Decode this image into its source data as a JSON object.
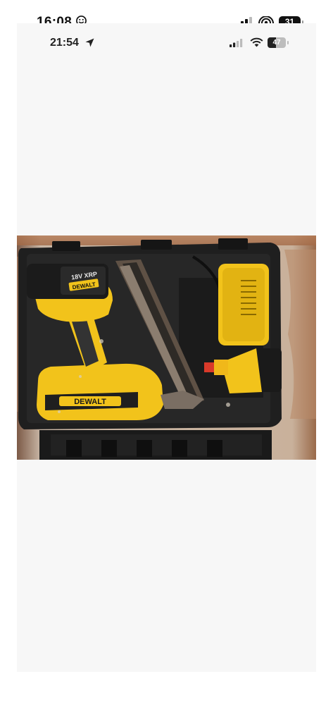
{
  "outer_status_bar": {
    "time": "16:08",
    "battery": "31",
    "icons": [
      "smiley-icon",
      "cellular-signal-icon",
      "hotspot-icon",
      "battery-icon"
    ]
  },
  "inner_status_bar": {
    "time": "21:54",
    "battery": "47",
    "battery_level": 0.47,
    "icons": [
      "location-arrow-icon",
      "cellular-signal-icon",
      "wifi-icon",
      "battery-icon"
    ]
  },
  "photo": {
    "brand_label": "DEWALT",
    "battery_label": "18V XRP",
    "colors": {
      "tool_yellow": "#f2c31b",
      "case_black": "#1c1c1c",
      "wall_brown": "#9b6b4c"
    }
  }
}
